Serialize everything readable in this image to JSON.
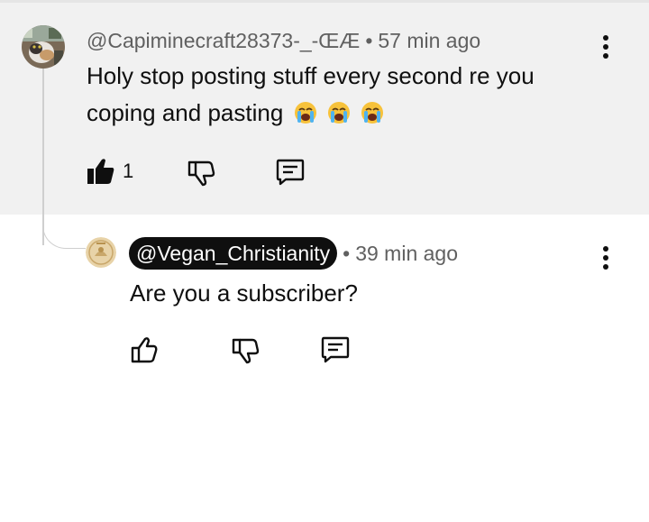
{
  "comment": {
    "handle": "@Capiminecraft28373-_-ŒÆ",
    "separator": "•",
    "time": "57 min ago",
    "text": "Holy stop posting stuff every second re you coping and pasting",
    "emojis": [
      "loudly-crying-face",
      "loudly-crying-face",
      "loudly-crying-face"
    ],
    "like_count": "1",
    "liked": true
  },
  "reply": {
    "handle": "@Vegan_Christianity",
    "separator": "•",
    "time": "39 min ago",
    "text": "Are you a subscriber?",
    "highlighted_handle": true
  },
  "colors": {
    "parent_background": "#f1f1f1",
    "meta_text": "#606060",
    "pill_background": "#0f0f0f"
  }
}
